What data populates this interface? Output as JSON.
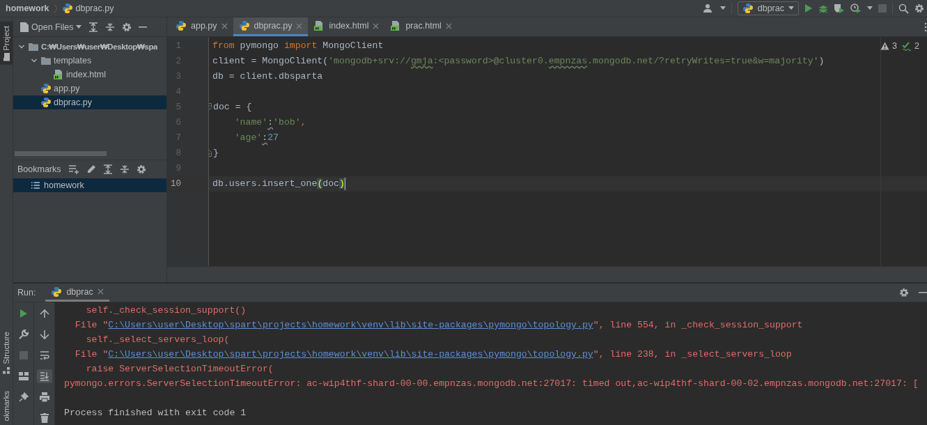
{
  "title_bar": {
    "breadcrumbs": [
      {
        "label": "homework",
        "kind": "folder"
      },
      {
        "label": "dbprac.py",
        "kind": "python"
      }
    ],
    "run_config": "dbprac"
  },
  "side_stripe": {
    "tabs": [
      {
        "label": "Project",
        "selected": true
      },
      {
        "label": "Structure",
        "selected": false
      },
      {
        "label": "okmarks",
        "selected": false
      }
    ]
  },
  "project_panel": {
    "view": "Open Files",
    "tree": [
      {
        "label": "C:₩Users₩user₩Desktop₩spa",
        "kind": "folder",
        "expanded": true,
        "selected": false,
        "children": [
          {
            "label": "templates",
            "kind": "folder",
            "expanded": true,
            "selected": false,
            "children": [
              {
                "label": "index.html",
                "kind": "html",
                "selected": false
              }
            ]
          },
          {
            "label": "app.py",
            "kind": "python",
            "selected": false
          },
          {
            "label": "dbprac.py",
            "kind": "python",
            "selected": true
          }
        ]
      }
    ]
  },
  "bookmarks_panel": {
    "title": "Bookmarks",
    "items": [
      {
        "label": "homework",
        "selected": true
      }
    ]
  },
  "editor": {
    "tabs": [
      {
        "label": "app.py",
        "kind": "python",
        "selected": false
      },
      {
        "label": "dbprac.py",
        "kind": "python",
        "selected": true
      },
      {
        "label": "index.html",
        "kind": "html",
        "selected": false
      },
      {
        "label": "prac.html",
        "kind": "html",
        "selected": false
      }
    ],
    "inspections": {
      "warnings": "3",
      "weak_warnings": "2"
    },
    "lines": [
      {
        "number": "1",
        "current": false,
        "kind": "plain",
        "tokens": [
          {
            "text": "from",
            "kind": "keyword"
          },
          {
            "text": " pymongo ",
            "kind": "plain"
          },
          {
            "text": "import",
            "kind": "keyword"
          },
          {
            "text": " MongoClient",
            "kind": "plain"
          }
        ]
      },
      {
        "number": "2",
        "current": false,
        "kind": "plain",
        "tokens": [
          {
            "text": "client = MongoClient(",
            "kind": "plain"
          },
          {
            "text": "'mongodb+srv://",
            "kind": "string"
          },
          {
            "text": "gmja",
            "kind": "string-typo"
          },
          {
            "text": ":<password>@cluster0.",
            "kind": "string"
          },
          {
            "text": "empnzas",
            "kind": "string-typo"
          },
          {
            "text": ".mongodb.net/?retryWrites=true&w=majority'",
            "kind": "string"
          },
          {
            "text": ")",
            "kind": "plain"
          }
        ]
      },
      {
        "number": "3",
        "current": false,
        "kind": "plain",
        "tokens": [
          {
            "text": "db = client.dbsparta",
            "kind": "plain"
          }
        ]
      },
      {
        "number": "4",
        "current": false,
        "kind": "plain"
      },
      {
        "number": "5",
        "current": false,
        "kind": "fold-start",
        "tokens": [
          {
            "text": "doc = {",
            "kind": "plain"
          }
        ]
      },
      {
        "number": "6",
        "current": false,
        "kind": "plain",
        "tokens": [
          {
            "text": "    'name'",
            "kind": "string"
          },
          {
            "text": ":",
            "kind": "plain-weak"
          },
          {
            "text": "'bob'",
            "kind": "string"
          },
          {
            "text": ",",
            "kind": "keyword"
          }
        ]
      },
      {
        "number": "7",
        "current": false,
        "kind": "plain",
        "tokens": [
          {
            "text": "    'age'",
            "kind": "string"
          },
          {
            "text": ":",
            "kind": "plain-weak"
          },
          {
            "text": "27",
            "kind": "number"
          }
        ]
      },
      {
        "number": "8",
        "current": false,
        "kind": "fold-end",
        "tokens": [
          {
            "text": "}",
            "kind": "plain"
          }
        ]
      },
      {
        "number": "9",
        "current": false,
        "kind": "plain"
      },
      {
        "number": "10",
        "current": true,
        "kind": "plain",
        "tokens": [
          {
            "text": "db.users.insert_one",
            "kind": "plain"
          },
          {
            "text": "(",
            "kind": "brace-match"
          },
          {
            "text": "doc",
            "kind": "plain"
          },
          {
            "text": ")",
            "kind": "brace-match"
          }
        ]
      }
    ]
  },
  "run_panel": {
    "title": "Run:",
    "tabs": [
      {
        "label": "dbprac",
        "selected": true
      }
    ],
    "output": [
      {
        "parts": [
          {
            "text": "    self._check_session_support()",
            "kind": "error"
          }
        ]
      },
      {
        "parts": [
          {
            "text": "  File \"",
            "kind": "error"
          },
          {
            "text": "C:\\Users\\user\\Desktop\\spart\\projects\\homework\\venv\\lib\\site-packages\\pymongo\\topology.py",
            "kind": "link"
          },
          {
            "text": "\", line 554, in _check_session_support",
            "kind": "error"
          }
        ]
      },
      {
        "parts": [
          {
            "text": "    self._select_servers_loop(",
            "kind": "error"
          }
        ]
      },
      {
        "parts": [
          {
            "text": "  File \"",
            "kind": "error"
          },
          {
            "text": "C:\\Users\\user\\Desktop\\spart\\projects\\homework\\venv\\lib\\site-packages\\pymongo\\topology.py",
            "kind": "link"
          },
          {
            "text": "\", line 238, in _select_servers_loop",
            "kind": "error"
          }
        ]
      },
      {
        "parts": [
          {
            "text": "    raise ServerSelectionTimeoutError(",
            "kind": "error"
          }
        ]
      },
      {
        "parts": [
          {
            "text": "pymongo.errors.ServerSelectionTimeoutError: ac-wip4thf-shard-00-00.empnzas.mongodb.net:27017: timed out,ac-wip4thf-shard-00-02.empnzas.mongodb.net:27017: [",
            "kind": "error"
          }
        ]
      },
      {
        "kind": "blank"
      },
      {
        "parts": [
          {
            "text": "Process finished with exit code 1",
            "kind": "plain"
          }
        ]
      }
    ]
  }
}
